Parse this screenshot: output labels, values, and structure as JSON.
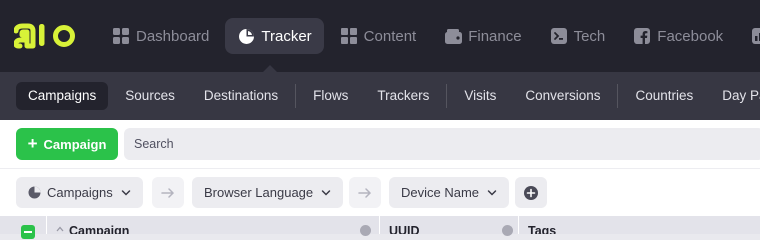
{
  "logo_text": "alo",
  "colors": {
    "topbar_bg": "#23232d",
    "subbar_bg": "#373743",
    "accent_green": "#2bc24a",
    "logo_yellow": "#d8f238"
  },
  "nav": {
    "items": [
      {
        "label": "Dashboard",
        "icon": "dashboard-grid-icon"
      },
      {
        "label": "Tracker",
        "icon": "tracker-pie-icon",
        "active": true
      },
      {
        "label": "Content",
        "icon": "content-grid-icon"
      },
      {
        "label": "Finance",
        "icon": "wallet-icon"
      },
      {
        "label": "Tech",
        "icon": "tech-chip-icon"
      },
      {
        "label": "Facebook",
        "icon": "facebook-icon"
      },
      {
        "label": "",
        "icon": "chart-icon"
      }
    ]
  },
  "subnav": {
    "items": [
      "Campaigns",
      "Sources",
      "Destinations",
      "Flows",
      "Trackers",
      "Visits",
      "Conversions",
      "Countries",
      "Day Parts"
    ],
    "active": "Campaigns"
  },
  "toolbar": {
    "add_campaign_label": "Campaign",
    "search_placeholder": "Search"
  },
  "grouping": {
    "chips": [
      "Campaigns",
      "Browser Language",
      "Device Name"
    ]
  },
  "table": {
    "columns": [
      "Campaign",
      "UUID",
      "Tags"
    ]
  }
}
